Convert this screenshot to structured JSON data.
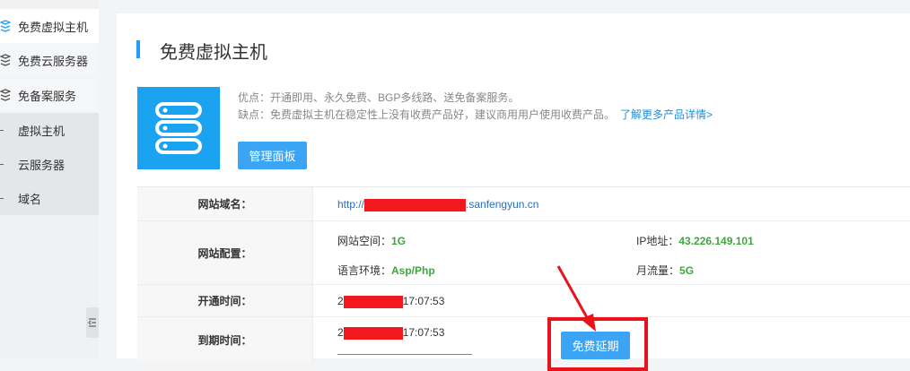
{
  "sidebar": {
    "items": [
      {
        "label": "免费虚拟主机",
        "icon": "layers-icon"
      },
      {
        "label": "免费云服务器",
        "icon": "layers-icon"
      },
      {
        "label": "免备案服务",
        "icon": "layers-icon"
      },
      {
        "label": "虚拟主机"
      },
      {
        "label": "云服务器"
      },
      {
        "label": "域名"
      }
    ],
    "collapse_icon": "collapse-icon"
  },
  "main": {
    "title": "免费虚拟主机",
    "desc_advantages": "优点：开通即用、永久免费、BGP多线路、送免备案服务。",
    "desc_disadvantages": "缺点：免费虚拟主机在稳定性上没有收费产品好，建议商用用户使用收费产品。",
    "more_link": "了解更多产品详情>",
    "manage_button": "管理面板",
    "extend_button": "免费延期"
  },
  "table": {
    "site_domain_label": "网站域名：",
    "site_domain_prefix": "http://",
    "site_domain_suffix": ".sanfengyun.cn",
    "site_config_label": "网站配置：",
    "space_label": "网站空间：",
    "space_value": "1G",
    "ip_label": "IP地址：",
    "ip_value": "43.226.149.101",
    "lang_label": "语言环境：",
    "lang_value": "Asp/Php",
    "traffic_label": "月流量：",
    "traffic_value": "5G",
    "open_time_label": "开通时间：",
    "open_time_prefix": "2",
    "open_time_suffix": "17:07:53",
    "expire_time_label": "到期时间：",
    "expire_time_prefix": "2",
    "expire_time_suffix": "17:07:53"
  },
  "colors": {
    "accent": "#1e9fff",
    "button": "#3ca4f5",
    "highlight": "#e8141b",
    "value_green": "#3fa63f"
  }
}
